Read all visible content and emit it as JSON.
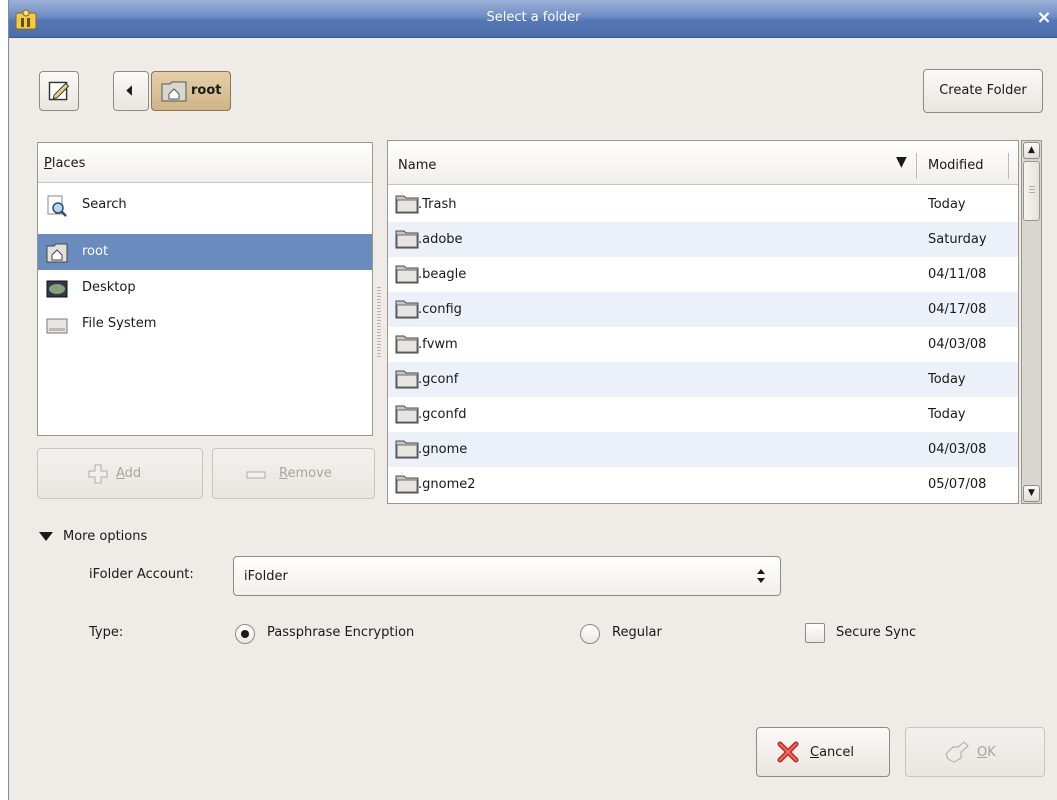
{
  "window": {
    "title": "Select a folder",
    "close_glyph": "×",
    "app_icon": "ifolder-icon"
  },
  "toolbar": {
    "edit_icon": "edit-location-icon",
    "back_icon": "left-arrow-icon",
    "path_button_label": "root",
    "create_folder_label": "Create Folder"
  },
  "places": {
    "header": "Places",
    "items": [
      {
        "label": "Search",
        "icon": "search-icon",
        "selected": false
      },
      {
        "label": "root",
        "icon": "home-folder-icon",
        "selected": true
      },
      {
        "label": "Desktop",
        "icon": "desktop-icon",
        "selected": false
      },
      {
        "label": "File System",
        "icon": "drive-icon",
        "selected": false
      }
    ],
    "add_label": "Add",
    "remove_label": "Remove"
  },
  "files": {
    "columns": {
      "name": "Name",
      "modified": "Modified"
    },
    "sort_indicator": "▼",
    "rows": [
      {
        "name": ".Trash",
        "modified": "Today"
      },
      {
        "name": ".adobe",
        "modified": "Saturday"
      },
      {
        "name": ".beagle",
        "modified": "04/11/08"
      },
      {
        "name": ".config",
        "modified": "04/17/08"
      },
      {
        "name": ".fvwm",
        "modified": "04/03/08"
      },
      {
        "name": ".gconf",
        "modified": "Today"
      },
      {
        "name": ".gconfd",
        "modified": "Today"
      },
      {
        "name": ".gnome",
        "modified": "04/03/08"
      },
      {
        "name": ".gnome2",
        "modified": "05/07/08"
      }
    ]
  },
  "options": {
    "more_options_label": "More options",
    "account_label": "iFolder Account:",
    "account_value": "iFolder",
    "type_label": "Type:",
    "type_passphrase": "Passphrase Encryption",
    "type_regular": "Regular",
    "secure_sync": "Secure Sync",
    "selected_type": "Passphrase Encryption",
    "secure_sync_checked": false
  },
  "actions": {
    "cancel_label": "Cancel",
    "ok_label": "OK"
  },
  "colors": {
    "titlebar": "#5677b6",
    "selection": "#6a8bbd",
    "window_bg": "#efebe7",
    "row_alt": "#ecf0f8"
  }
}
